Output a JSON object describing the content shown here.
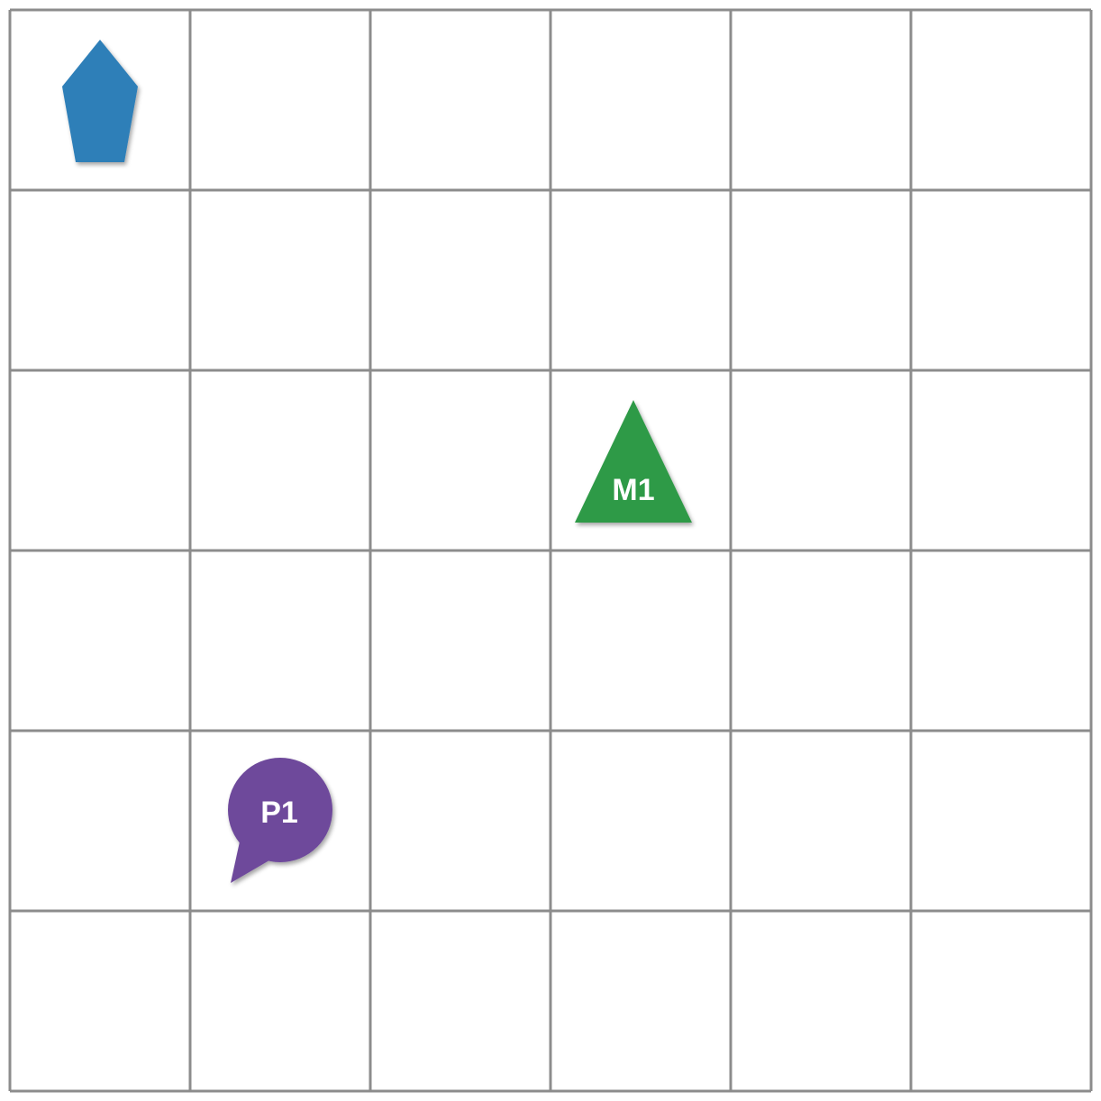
{
  "board": {
    "rows": 6,
    "cols": 6,
    "line_color": "#8c8c8c",
    "background": "#ffffff"
  },
  "pieces": [
    {
      "id": "pentagon",
      "shape": "pentagon",
      "label": "",
      "color": "#2f7fb8",
      "row": 0,
      "col": 0
    },
    {
      "id": "m1",
      "shape": "triangle",
      "label": "M1",
      "color": "#2e9a47",
      "row": 2,
      "col": 3
    },
    {
      "id": "p1",
      "shape": "speech-bubble",
      "label": "P1",
      "color": "#6e4a9b",
      "row": 4,
      "col": 1
    }
  ]
}
